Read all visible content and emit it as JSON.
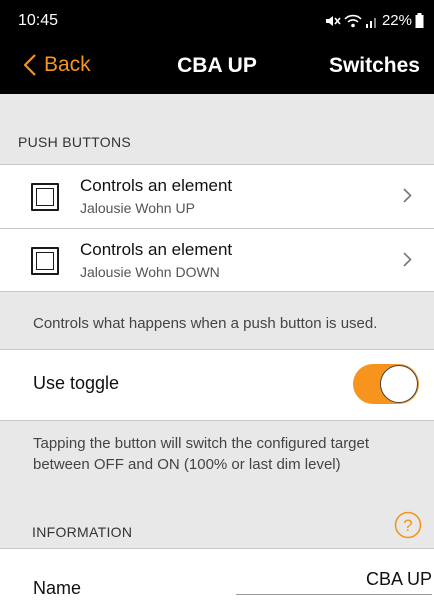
{
  "status_bar": {
    "time": "10:45",
    "battery_text": "22%",
    "icons": [
      "mute-icon",
      "wifi-icon",
      "signal-icon",
      "battery-icon"
    ]
  },
  "nav": {
    "back_label": "Back",
    "title": "CBA UP",
    "right_label": "Switches",
    "accent_color": "#f7941d"
  },
  "push_buttons": {
    "header": "PUSH BUTTONS",
    "items": [
      {
        "title": "Controls an element",
        "subtitle": "Jalousie Wohn UP"
      },
      {
        "title": "Controls an element",
        "subtitle": "Jalousie Wohn DOWN"
      }
    ],
    "footer": "Controls what happens when a push button is used."
  },
  "toggle": {
    "label": "Use toggle",
    "checked": true,
    "note": "Tapping the button will switch the configured target between OFF and ON (100% or last dim level)"
  },
  "information": {
    "header": "INFORMATION",
    "name_label": "Name",
    "name_value": "CBA UP"
  }
}
